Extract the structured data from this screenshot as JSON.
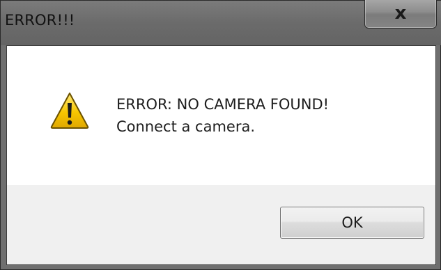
{
  "window": {
    "title": "ERROR!!!",
    "close_glyph": "x"
  },
  "icon": {
    "name": "warning-icon",
    "colors": {
      "fill": "#f7c600",
      "outline": "#6b5200",
      "mark": "#1a1a1a"
    }
  },
  "message": {
    "line1": "ERROR: NO CAMERA FOUND!",
    "line2": "Connect a camera."
  },
  "buttons": {
    "ok_label": "OK"
  },
  "colors": {
    "titlebar": "#6f6f6f",
    "content_bg": "#ffffff",
    "button_area_bg": "#f0f0f0"
  }
}
